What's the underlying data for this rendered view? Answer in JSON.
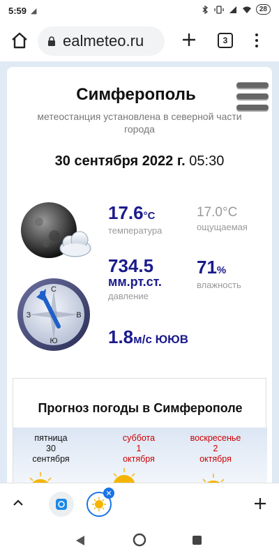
{
  "status_bar": {
    "time": "5:59",
    "battery": "28"
  },
  "browser": {
    "url": "ealmeteo.ru",
    "tab_count": "3"
  },
  "weather": {
    "city": "Симферополь",
    "station_note": "метеостанция установлена в северной части города",
    "date": "30 сентября 2022 г.",
    "time": "05:30",
    "temperature": {
      "value": "17.6",
      "unit": "°C",
      "label": "температура"
    },
    "feels_like": {
      "value": "17.0°C",
      "label": "ощущаемая"
    },
    "pressure": {
      "value": "734.5",
      "unit": "мм.рт.ст.",
      "label": "давление"
    },
    "humidity": {
      "value": "71",
      "unit": "%",
      "label": "влажность"
    },
    "wind": {
      "value": "1.8",
      "unit": "м/с ЮЮВ"
    },
    "compass_labels": {
      "n": "С",
      "s": "Ю",
      "w": "З",
      "e": "В"
    }
  },
  "forecast": {
    "title": "Прогноз погоды в Симферополе",
    "days": [
      {
        "weekday": "пятница",
        "day": "30",
        "month": "сентября",
        "weekend": false
      },
      {
        "weekday": "суббота",
        "day": "1",
        "month": "октября",
        "weekend": true
      },
      {
        "weekday": "воскресенье",
        "day": "2",
        "month": "октября",
        "weekend": true
      }
    ]
  },
  "colors": {
    "accent": "#1a1a8c",
    "weekend": "#cc0000",
    "tab_active": "#1a73e8"
  }
}
